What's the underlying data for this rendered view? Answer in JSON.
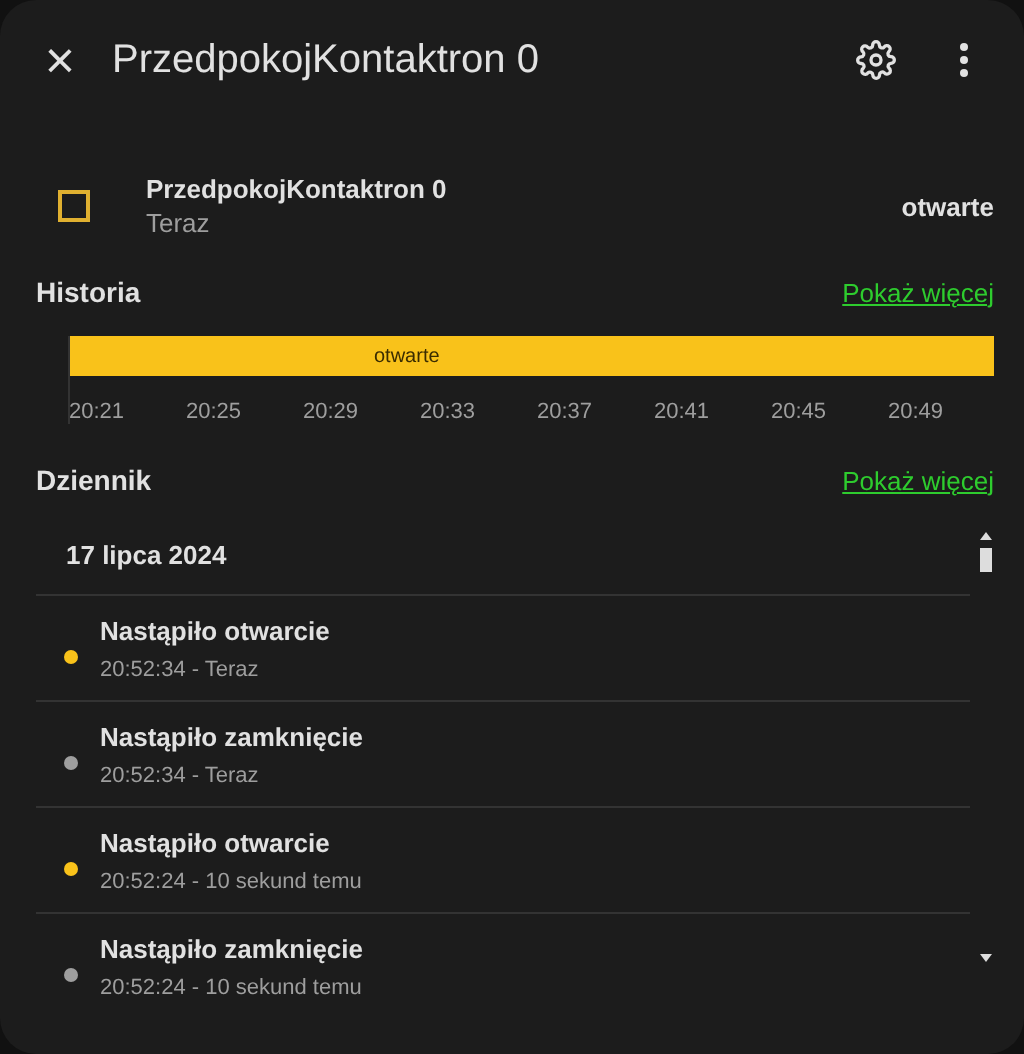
{
  "header": {
    "close": "×",
    "title": "PrzedpokojKontaktron 0"
  },
  "entity": {
    "name": "PrzedpokojKontaktron 0",
    "time": "Teraz",
    "state": "otwarte",
    "on": true
  },
  "history": {
    "title": "Historia",
    "more": "Pokaż więcej",
    "bar_label": "otwarte",
    "ticks": [
      "20:21",
      "20:25",
      "20:29",
      "20:33",
      "20:37",
      "20:41",
      "20:45",
      "20:49"
    ]
  },
  "logbook": {
    "title": "Dziennik",
    "more": "Pokaż więcej",
    "date": "17 lipca 2024",
    "entries": [
      {
        "title": "Nastąpiło otwarcie",
        "time": "20:52:34 - Teraz",
        "color": "#f9c21a"
      },
      {
        "title": "Nastąpiło zamknięcie",
        "time": "20:52:34 - Teraz",
        "color": "#9e9e9e"
      },
      {
        "title": "Nastąpiło otwarcie",
        "time": "20:52:24 - 10 sekund temu",
        "color": "#f9c21a"
      },
      {
        "title": "Nastąpiło zamknięcie",
        "time": "20:52:24 - 10 sekund temu",
        "color": "#9e9e9e"
      }
    ]
  }
}
